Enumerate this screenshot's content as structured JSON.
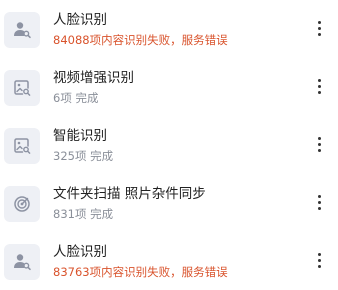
{
  "items": [
    {
      "title": "人脸识别",
      "status": "84088项内容识别失败，服务错误",
      "status_kind": "error",
      "icon": "person-search-icon"
    },
    {
      "title": "视频增强识别",
      "status": "6项 完成",
      "status_kind": "ok",
      "icon": "image-search-icon"
    },
    {
      "title": "智能识别",
      "status": "325项 完成",
      "status_kind": "ok",
      "icon": "image-search-icon"
    },
    {
      "title": "文件夹扫描 照片杂件同步",
      "status": "831项 完成",
      "status_kind": "ok",
      "icon": "radar-scan-icon"
    },
    {
      "title": "人脸识别",
      "status": "83763项内容识别失败，服务错误",
      "status_kind": "error",
      "icon": "person-search-icon"
    }
  ],
  "colors": {
    "error": "#d9532c",
    "ok": "#8a8f99",
    "icon": "#8d93a3",
    "icon_bg": "#eef0f5"
  }
}
